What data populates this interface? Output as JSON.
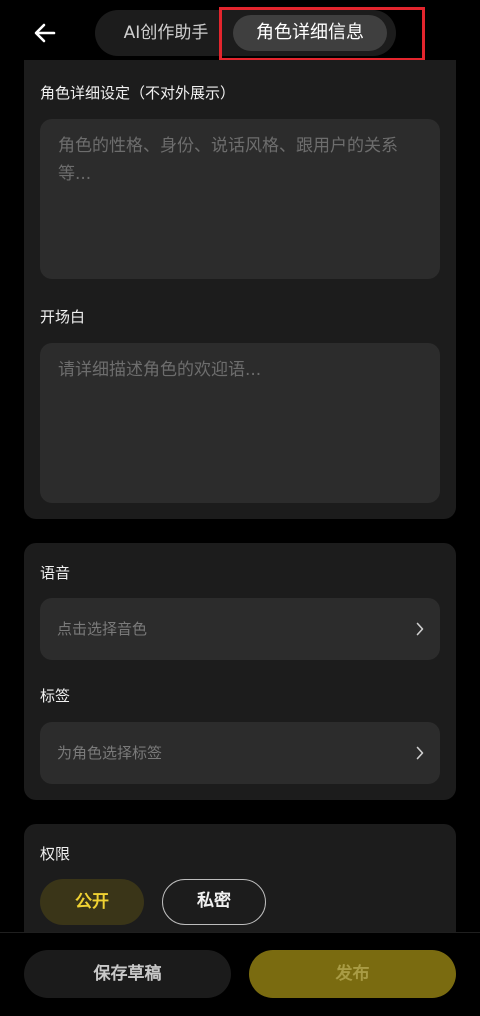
{
  "header": {
    "tabs": [
      {
        "label": "AI创作助手",
        "active": false
      },
      {
        "label": "角色详细信息",
        "active": true
      }
    ]
  },
  "character": {
    "settings_label": "角色详细设定（不对外展示）",
    "settings_placeholder": "角色的性格、身份、说话风格、跟用户的关系等...",
    "settings_value": "",
    "opening_label": "开场白",
    "opening_placeholder": "请详细描述角色的欢迎语...",
    "opening_value": ""
  },
  "voice": {
    "label": "语音",
    "placeholder": "点击选择音色"
  },
  "tags": {
    "label": "标签",
    "placeholder": "为角色选择标签"
  },
  "permission": {
    "label": "权限",
    "options": [
      "公开",
      "私密"
    ],
    "selected": "公开"
  },
  "footer": {
    "save_label": "保存草稿",
    "publish_label": "发布"
  },
  "colors": {
    "accent": "#f0d232",
    "publish_bg": "#7a6b10",
    "highlight": "#e3252d"
  },
  "icons": {
    "back": "arrow-left-icon",
    "chevron": "chevron-right-icon"
  }
}
